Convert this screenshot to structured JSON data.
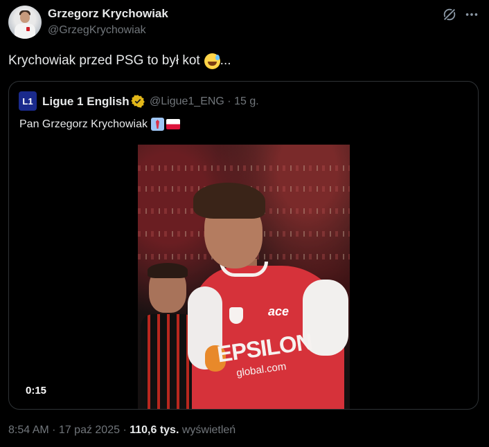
{
  "author": {
    "display_name": "Grzegorz Krychowiak",
    "handle": "@GrzegKrychowiak"
  },
  "actions": {
    "grok_icon": "grok-icon",
    "more_icon": "more-icon"
  },
  "tweet": {
    "text": "Krychowiak przed PSG to był kot",
    "emoji": "grinning-sweat-emoji",
    "trailing": "..."
  },
  "quote": {
    "avatar_text": "L1",
    "display_name": "Ligue 1 English",
    "verified": "gold-verified-badge",
    "handle_time": "@Ligue1_ENG · 15 g.",
    "text": "Pan Grzegorz Krychowiak",
    "video": {
      "timestamp": "0:15",
      "sponsor_text": "EPSILON",
      "sponsor_sub": "global.com",
      "shirt_logo": "ace"
    }
  },
  "meta": {
    "time_date": "8:54 AM · 17 paź 2025 · ",
    "views_count": "110,6 tys.",
    "views_label": "wyświetleń"
  },
  "colors": {
    "background": "#000000",
    "text_primary": "#e7e9ea",
    "text_secondary": "#71767b",
    "border": "#2f3336",
    "verified_gold": "#e2b719"
  }
}
